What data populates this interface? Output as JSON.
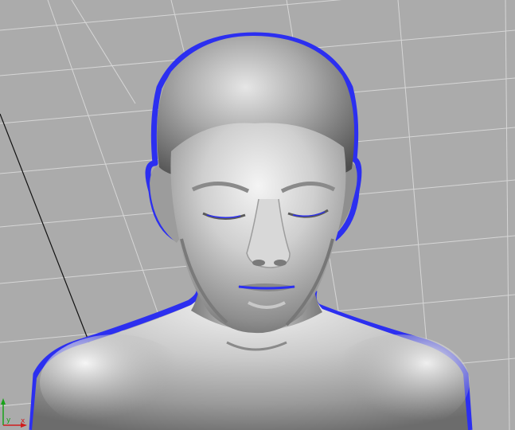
{
  "viewport": {
    "kind": "3d-perspective-viewport",
    "background_color": "#ababab",
    "grid_color": "#d6d6d6",
    "highlight_outline_color": "#2c2ff0",
    "model_color": "#b9b9b9"
  },
  "axis_triad": {
    "x_color": "#d01c1c",
    "y_color": "#1aa21a",
    "x_label": "x",
    "y_label": "y"
  },
  "model": {
    "selected": true,
    "kind": "human head and shoulders mesh"
  }
}
